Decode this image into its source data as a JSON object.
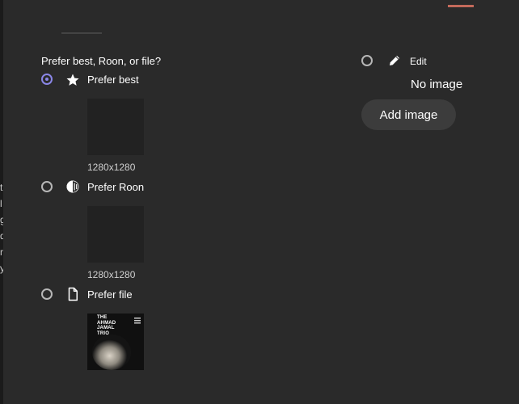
{
  "background": {
    "fragments": [
      "t",
      "l",
      "g",
      "d",
      "r",
      "y"
    ]
  },
  "dialog": {
    "question": "Prefer best, Roon, or file?",
    "options": [
      {
        "label": "Prefer best",
        "icon": "star-icon",
        "selected": true,
        "dimensions": "1280x1280"
      },
      {
        "label": "Prefer Roon",
        "icon": "roon-logo-icon",
        "selected": false,
        "dimensions": "1280x1280"
      },
      {
        "label": "Prefer file",
        "icon": "file-icon",
        "selected": false
      }
    ],
    "edit": {
      "label": "Edit",
      "icon": "pencil-icon",
      "selected": false
    },
    "no_image": "No image",
    "add_image_button": "Add image",
    "album_cover": {
      "line1": "THE",
      "line2": "AHMAD",
      "line3": "JAMAL",
      "line4": "TRIO"
    }
  },
  "colors": {
    "accent": "#8a86e6",
    "tab_accent": "#c46a5b",
    "dialog_bg": "#2a2a2a"
  }
}
